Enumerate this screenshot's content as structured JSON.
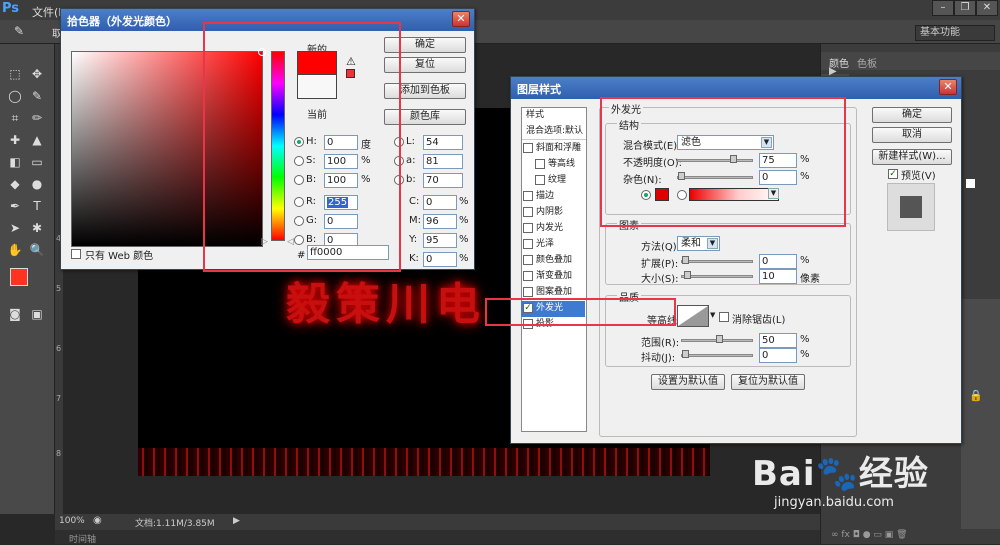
{
  "app": {
    "logo": "Ps",
    "menu_first": "文件(F)",
    "workspace": "基本功能",
    "opt_label": "取"
  },
  "status": {
    "zoom": "100%",
    "doc": "文档:1.11M/3.85M",
    "timeline": "时间轴"
  },
  "ruler_marks": [
    "4",
    "5",
    "6",
    "7",
    "8"
  ],
  "canvas_text": "毅策川电",
  "right_panel": {
    "tab1": "颜色",
    "tab2": "色板"
  },
  "watermark": {
    "brand": "Bai",
    "suffix": "经验",
    "url": "jingyan.baidu.com"
  },
  "picker": {
    "title": "拾色器（外发光颜色）",
    "ok": "确定",
    "reset": "复位",
    "add_swatch": "添加到色板",
    "color_lib": "颜色库",
    "new_label": "新的",
    "current_label": "当前",
    "web_only": "只有 Web 颜色",
    "hsb": [
      {
        "k": "H:",
        "v": "0",
        "u": "度"
      },
      {
        "k": "S:",
        "v": "100",
        "u": "%"
      },
      {
        "k": "B:",
        "v": "100",
        "u": "%"
      }
    ],
    "rgb": [
      {
        "k": "R:",
        "v": "255"
      },
      {
        "k": "G:",
        "v": "0"
      },
      {
        "k": "B:",
        "v": "0"
      }
    ],
    "lab": [
      {
        "k": "L:",
        "v": "54"
      },
      {
        "k": "a:",
        "v": "81"
      },
      {
        "k": "b:",
        "v": "70"
      }
    ],
    "cmyk": [
      {
        "k": "C:",
        "v": "0",
        "u": "%"
      },
      {
        "k": "M:",
        "v": "96",
        "u": "%"
      },
      {
        "k": "Y:",
        "v": "95",
        "u": "%"
      },
      {
        "k": "K:",
        "v": "0",
        "u": "%"
      }
    ],
    "hex_label": "#",
    "hex": "ff0000",
    "new_color": "#ff0000",
    "current_color": "#f8f8f8"
  },
  "layer_style": {
    "title": "图层样式",
    "ok": "确定",
    "cancel": "取消",
    "new_style": "新建样式(W)...",
    "preview": "预览(V)",
    "list_header": "样式",
    "list_blend": "混合选项:默认",
    "items": [
      "斜面和浮雕",
      "等高线",
      "纹理",
      "描边",
      "内阴影",
      "内发光",
      "光泽",
      "颜色叠加",
      "渐变叠加",
      "图案叠加",
      "外发光",
      "投影"
    ],
    "section": "外发光",
    "structure": "结构",
    "blend_mode_label": "混合模式(E):",
    "blend_mode": "滤色",
    "opacity_label": "不透明度(O):",
    "opacity": "75",
    "opacity_unit": "%",
    "noise_label": "杂色(N):",
    "noise": "0",
    "noise_unit": "%",
    "elements": "图素",
    "method_label": "方法(Q):",
    "method": "柔和",
    "spread_label": "扩展(P):",
    "spread": "0",
    "spread_unit": "%",
    "size_label": "大小(S):",
    "size": "10",
    "size_unit": "像素",
    "quality": "品质",
    "contour_label": "等高线:",
    "antialias": "消除锯齿(L)",
    "range_label": "范围(R):",
    "range": "50",
    "range_unit": "%",
    "jitter_label": "抖动(J):",
    "jitter": "0",
    "jitter_unit": "%",
    "make_default": "设置为默认值",
    "reset_default": "复位为默认值",
    "glow_color": "#e00000"
  }
}
